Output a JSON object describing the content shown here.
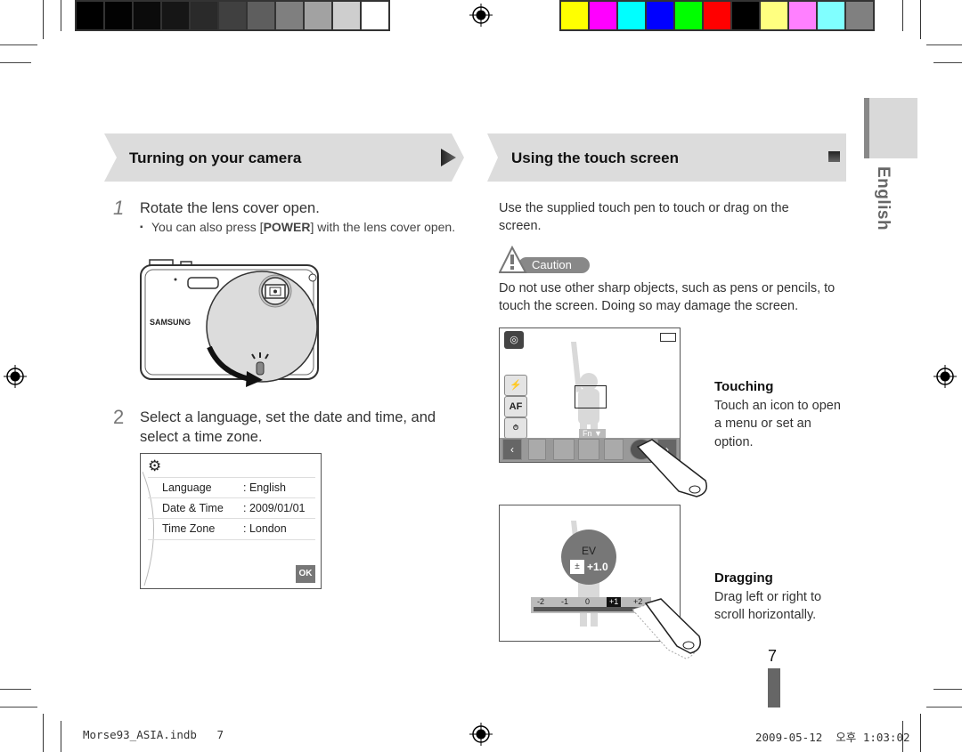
{
  "print_marks": {
    "grayscale_swatches": [
      "#000000",
      "#020202",
      "#0b0b0b",
      "#161616",
      "#2a2a2a",
      "#404040",
      "#5e5e5e",
      "#7f7f7f",
      "#a2a2a2",
      "#cecece",
      "#ffffff"
    ],
    "color_swatches": [
      "#ffff00",
      "#ff00ff",
      "#00ffff",
      "#0000ff",
      "#00ff00",
      "#ff0000",
      "#000000",
      "#ffff80",
      "#ff80ff",
      "#80ffff",
      "#808080"
    ]
  },
  "left_section": {
    "title": "Turning on your camera",
    "next_icon": "triangle-right-icon",
    "steps": [
      {
        "number": "1",
        "text": "Rotate the lens cover open.",
        "bullet_pre": "You can also press [",
        "bullet_bold": "POWER",
        "bullet_post": "] with the lens cover open."
      },
      {
        "number": "2",
        "text": "Select a language, set the date and time, and select a time zone."
      }
    ],
    "camera_brand": "SAMSUNG",
    "settings_screen": {
      "icon": "gear-icon",
      "rows": [
        {
          "label": "Language",
          "value": ": English"
        },
        {
          "label": "Date & Time",
          "value": ": 2009/01/01"
        },
        {
          "label": "Time Zone",
          "value": ": London"
        }
      ],
      "ok_label": "OK"
    }
  },
  "right_section": {
    "title": "Using the touch screen",
    "intro": "Use the supplied touch pen to touch or drag on the screen.",
    "caution_label": "Caution",
    "caution_text": "Do not use other sharp objects, such as pens or pencils, to touch the screen. Doing so may damage the screen.",
    "touching": {
      "title": "Touching",
      "text": "Touch an icon to open a menu or set an option.",
      "screen": {
        "side_buttons": [
          "flash",
          "AF",
          "OFF"
        ],
        "fn_label": "Fn ▼",
        "toolbar": [
          "prev",
          "ev",
          "size",
          "iso",
          "display",
          "shutter",
          "next"
        ]
      }
    },
    "dragging": {
      "title": "Dragging",
      "text": "Drag left or right to scroll horizontally.",
      "screen": {
        "ev_label": "EV",
        "ev_value": "+1.0",
        "scale": [
          "-2",
          "-1",
          "0",
          "+1",
          "+2"
        ],
        "selected": "+1"
      }
    }
  },
  "side_tab": {
    "label": "English"
  },
  "page_number": "7",
  "footer": {
    "file": "Morse93_ASIA.indb   7",
    "timestamp": "2009-05-12  오후 1:03:02"
  }
}
